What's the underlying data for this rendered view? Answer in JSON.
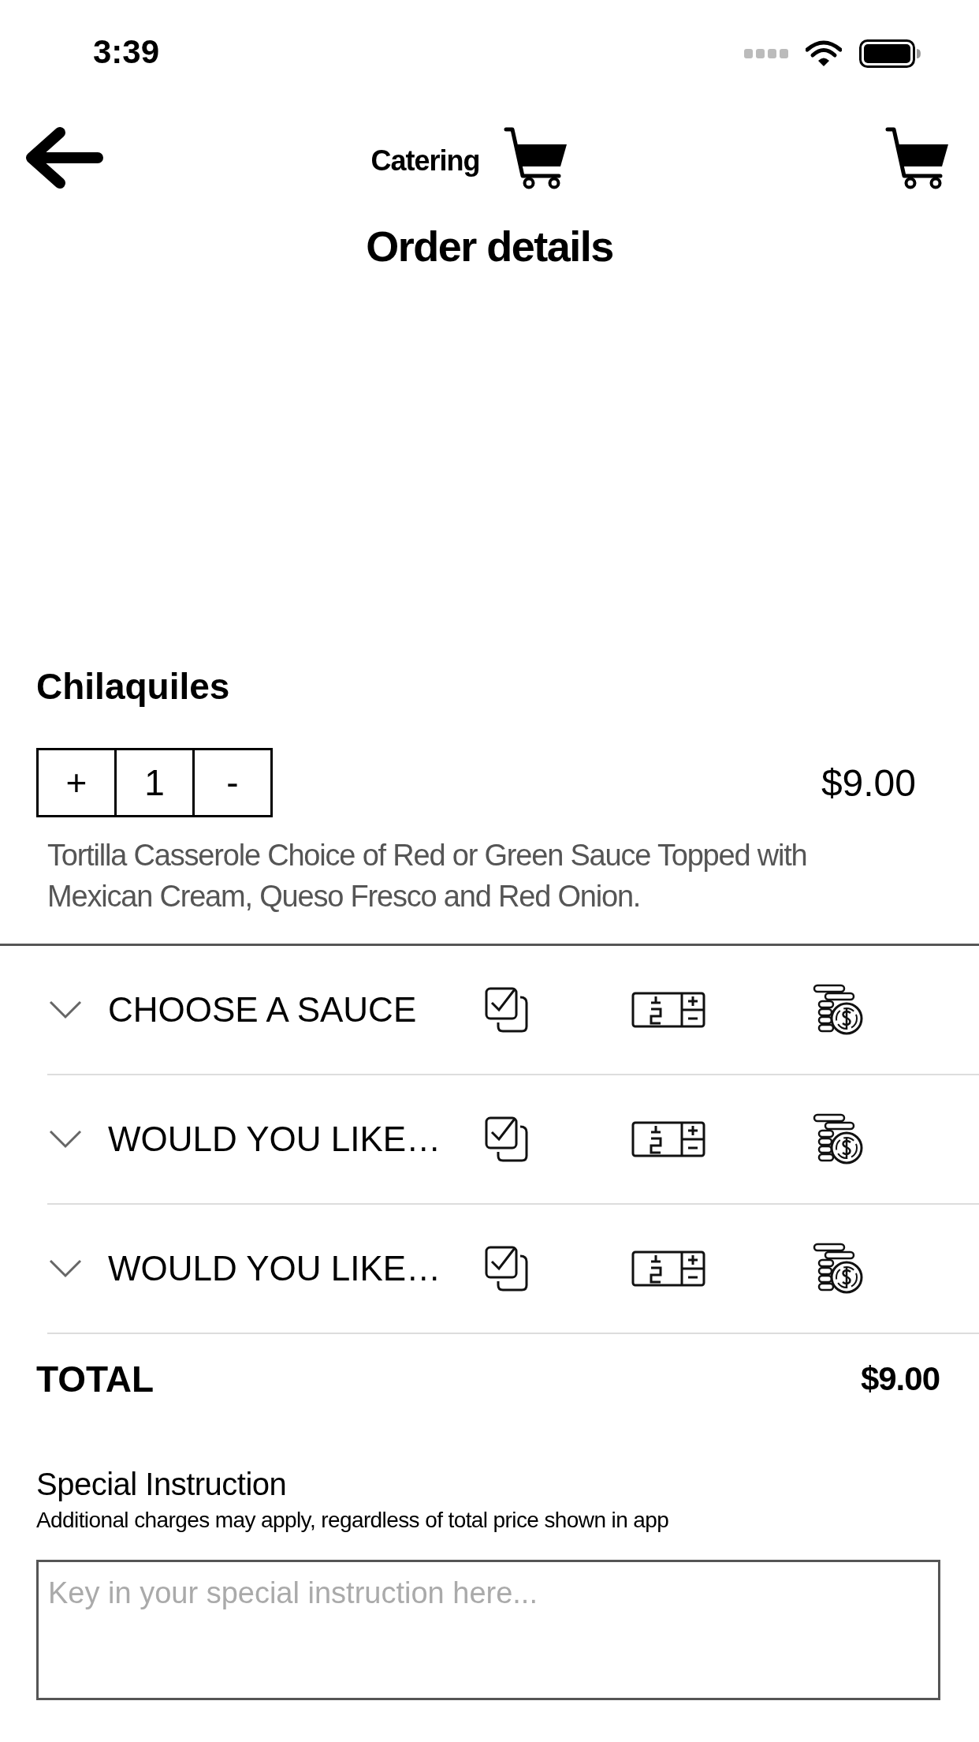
{
  "status_bar": {
    "time": "3:39"
  },
  "header": {
    "title": "Catering",
    "page_title": "Order details"
  },
  "item": {
    "name": "Chilaquiles",
    "stepper": {
      "increase": "+",
      "quantity": "1",
      "decrease": "-"
    },
    "price": "$9.00",
    "description": "Tortilla Casserole Choice of Red or Green Sauce Topped with Mexican Cream, Queso Fresco and Red Onion."
  },
  "options": [
    {
      "label": "CHOOSE A SAUCE",
      "expanded": false
    },
    {
      "label": "WOULD YOU LIKE…",
      "expanded": false
    },
    {
      "label": "WOULD YOU LIKE…",
      "expanded": false
    }
  ],
  "total": {
    "label": "TOTAL",
    "amount": "$9.00"
  },
  "special_instruction": {
    "title": "Special Instruction",
    "note": "Additional charges may apply, regardless of total price shown in app",
    "placeholder": "Key in your special instruction here..."
  }
}
